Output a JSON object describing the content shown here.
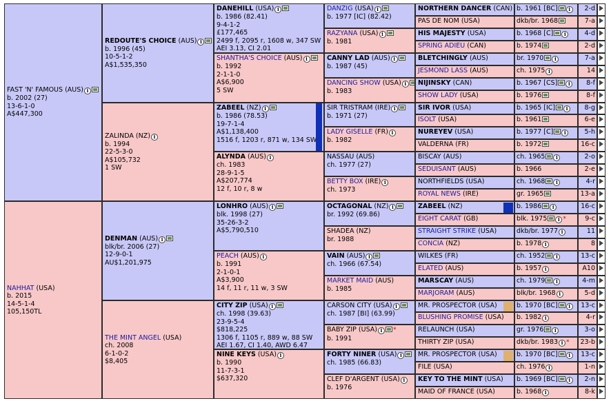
{
  "pedigree": {
    "g1": [
      {
        "name": "FAST 'N' FAMOUS",
        "nat": "(AUS)",
        "lines": [
          "b. 2002 (27)",
          "13-6-1-0",
          "A$447,300"
        ],
        "sex": "m",
        "bold": false,
        "link": false,
        "icons": [
          "info",
          "photo"
        ]
      },
      {
        "name": "NAHHAT",
        "nat": "(USA)",
        "lines": [
          "b. 2015",
          "14-5-1-4",
          "105,150TL"
        ],
        "sex": "f",
        "bold": false,
        "link": true,
        "icons": []
      }
    ],
    "g2": [
      {
        "name": "REDOUTE'S CHOICE",
        "nat": "(AUS)",
        "lines": [
          "b. 1996 (45)",
          "10-5-1-2",
          "A$1,535,350"
        ],
        "sex": "m",
        "bold": true,
        "link": false,
        "icons": [
          "info",
          "photo"
        ]
      },
      {
        "name": "ZALINDA",
        "nat": "(NZ)",
        "lines": [
          "b. 1994",
          "22-5-3-0",
          "A$105,732",
          "1 SW"
        ],
        "sex": "f",
        "bold": false,
        "link": false,
        "icons": [
          "info"
        ]
      },
      {
        "name": "DENMAN",
        "nat": "(AUS)",
        "lines": [
          "blk/br. 2006 (27)",
          "12-9-0-1",
          "AU$1,201,975"
        ],
        "sex": "m",
        "bold": true,
        "link": false,
        "icons": [
          "info",
          "photo"
        ]
      },
      {
        "name": "THE MINT ANGEL",
        "nat": "(USA)",
        "lines": [
          "ch. 2008",
          "6-1-0-2",
          "$8,405"
        ],
        "sex": "f",
        "bold": false,
        "link": true,
        "icons": []
      }
    ],
    "g3": [
      {
        "name": "DANEHILL",
        "nat": "(USA)",
        "lines": [
          "b. 1986 (82.41)",
          "9-4-1-2",
          "£177,465",
          "2499 f, 2095 r, 1608 w, 347 SW",
          "AEI 3.13, CI 2.01"
        ],
        "sex": "m",
        "bold": true,
        "link": false,
        "icons": [
          "info",
          "photo"
        ]
      },
      {
        "name": "SHANTHA'S CHOICE",
        "nat": "(AUS)",
        "lines": [
          "b. 1992",
          "2-1-1-0",
          "A$6,900",
          "5 SW"
        ],
        "sex": "f",
        "bold": false,
        "link": true,
        "icons": [
          "info",
          "photo"
        ]
      },
      {
        "name": "ZABEEL",
        "nat": "(NZ)",
        "lines": [
          "b. 1986 (78.53)",
          "19-7-1-4",
          "A$1,138,400",
          "1516 f, 1203 r, 871 w, 134 SW"
        ],
        "sex": "m",
        "bold": true,
        "link": false,
        "icons": [
          "info",
          "photo"
        ]
      },
      {
        "name": "ALYNDA",
        "nat": "(AUS)",
        "lines": [
          "ch. 1983",
          "28-9-1-5",
          "A$207,774",
          "12 f, 10 r, 8 w"
        ],
        "sex": "f",
        "bold": true,
        "link": false,
        "icons": [
          "info"
        ]
      },
      {
        "name": "LONHRO",
        "nat": "(AUS)",
        "lines": [
          "blk. 1998 (27)",
          "35-26-3-2",
          "A$5,790,510"
        ],
        "sex": "m",
        "bold": true,
        "link": false,
        "icons": [
          "info",
          "photo"
        ]
      },
      {
        "name": "PEACH",
        "nat": "(AUS)",
        "lines": [
          "b. 1991",
          "2-1-0-1",
          "A$3,900",
          "14 f, 11 r, 11 w, 3 SW"
        ],
        "sex": "f",
        "bold": false,
        "link": true,
        "icons": [
          "info"
        ]
      },
      {
        "name": "CITY ZIP",
        "nat": "(USA)",
        "lines": [
          "ch. 1998 (39.63)",
          "23-9-5-4",
          "$818,225",
          "1306 f, 1105 r, 889 w, 88 SW",
          "AEI 1.67, CI 1.40, AWD 6.47"
        ],
        "sex": "m",
        "bold": true,
        "link": false,
        "icons": [
          "info",
          "photo"
        ]
      },
      {
        "name": "NINE KEYS",
        "nat": "(USA)",
        "lines": [
          "b. 1990",
          "11-7-3-1",
          "$637,320"
        ],
        "sex": "f",
        "bold": true,
        "link": false,
        "icons": [
          "info"
        ]
      }
    ],
    "g4": [
      {
        "name": "DANZIG",
        "nat": "(USA)",
        "lines": [
          "b. 1977 [IC] (82.42)"
        ],
        "sex": "m",
        "bold": false,
        "link": true,
        "icons": [
          "info",
          "photo"
        ]
      },
      {
        "name": "RAZYANA",
        "nat": "(USA)",
        "lines": [
          "b. 1981"
        ],
        "sex": "f",
        "bold": false,
        "link": true,
        "icons": [
          "info",
          "photo"
        ]
      },
      {
        "name": "CANNY LAD",
        "nat": "(AUS)",
        "lines": [
          "b. 1987 (45)"
        ],
        "sex": "m",
        "bold": true,
        "link": false,
        "icons": [
          "info",
          "photo"
        ]
      },
      {
        "name": "DANCING SHOW",
        "nat": "(USA)",
        "lines": [
          "b. 1983"
        ],
        "sex": "f",
        "bold": false,
        "link": true,
        "icons": [
          "info",
          "photo"
        ]
      },
      {
        "name": "SIR TRISTRAM",
        "nat": "(IRE)",
        "lines": [
          "b. 1971 (27)"
        ],
        "sex": "m",
        "bold": false,
        "link": false,
        "icons": [
          "info",
          "photo"
        ]
      },
      {
        "name": "LADY GISELLE",
        "nat": "(FR)",
        "lines": [
          "b. 1982"
        ],
        "sex": "f",
        "bold": false,
        "link": true,
        "icons": [
          "info"
        ]
      },
      {
        "name": "NASSAU",
        "nat": "(AUS)",
        "lines": [
          "ch. 1977 (27)"
        ],
        "sex": "m",
        "bold": false,
        "link": false,
        "icons": []
      },
      {
        "name": "BETTY BOX",
        "nat": "(IRE)",
        "lines": [
          "ch. 1973"
        ],
        "sex": "f",
        "bold": false,
        "link": true,
        "icons": [
          "info"
        ]
      },
      {
        "name": "OCTAGONAL",
        "nat": "(NZ)",
        "lines": [
          "br. 1992 (69.86)"
        ],
        "sex": "m",
        "bold": true,
        "link": false,
        "icons": [
          "info",
          "photo"
        ]
      },
      {
        "name": "SHADEA",
        "nat": "(NZ)",
        "lines": [
          "br. 1988"
        ],
        "sex": "f",
        "bold": false,
        "link": false,
        "icons": []
      },
      {
        "name": "VAIN",
        "nat": "(AUS)",
        "lines": [
          "ch. 1966 (67.54)"
        ],
        "sex": "m",
        "bold": true,
        "link": false,
        "icons": [
          "info",
          "photo"
        ]
      },
      {
        "name": "MARKET MAID",
        "nat": "(AUS)",
        "lines": [
          "b. 1985"
        ],
        "sex": "f",
        "bold": false,
        "link": true,
        "icons": []
      },
      {
        "name": "CARSON CITY",
        "nat": "(USA)",
        "lines": [
          "ch. 1987 [BI] (63.99)"
        ],
        "sex": "m",
        "bold": false,
        "link": false,
        "icons": [
          "info",
          "photo"
        ]
      },
      {
        "name": "BABY ZIP",
        "nat": "(USA)",
        "lines": [
          "b. 1991"
        ],
        "sex": "f",
        "bold": false,
        "link": false,
        "icons": [
          "info",
          "photo"
        ],
        "star": "*"
      },
      {
        "name": "FORTY NINER",
        "nat": "(USA)",
        "lines": [
          "ch. 1985 (66.83)"
        ],
        "sex": "m",
        "bold": true,
        "link": false,
        "icons": [
          "info",
          "photo"
        ]
      },
      {
        "name": "CLEF D'ARGENT",
        "nat": "(USA)",
        "lines": [
          "b. 1976"
        ],
        "sex": "f",
        "bold": false,
        "link": false,
        "icons": [
          "info"
        ]
      }
    ],
    "g5": [
      {
        "name": "NORTHERN DANCER",
        "nat": "(CAN)",
        "info": "b. 1961 [BC]",
        "icons": [
          "photo",
          "info"
        ],
        "fam": "2-d",
        "sex": "m",
        "bold": true,
        "link": false
      },
      {
        "name": "PAS DE NOM",
        "nat": "(USA)",
        "info": "dkb/br. 1968",
        "icons": [
          "photo"
        ],
        "fam": "7-a",
        "sex": "f",
        "bold": false,
        "link": false
      },
      {
        "name": "HIS MAJESTY",
        "nat": "(USA)",
        "info": "b. 1968 [C]",
        "icons": [
          "photo",
          "info"
        ],
        "fam": "4-d",
        "sex": "m",
        "bold": true,
        "link": false
      },
      {
        "name": "SPRING ADIEU",
        "nat": "(CAN)",
        "info": "b. 1974",
        "icons": [
          "photo"
        ],
        "fam": "2-d",
        "sex": "f",
        "bold": false,
        "link": true
      },
      {
        "name": "BLETCHINGLY",
        "nat": "(AUS)",
        "info": "br. 1970",
        "icons": [
          "photo",
          "info"
        ],
        "fam": "7-a",
        "sex": "m",
        "bold": true,
        "link": false
      },
      {
        "name": "JESMOND LASS",
        "nat": "(AUS)",
        "info": "ch. 1975",
        "icons": [
          "info"
        ],
        "fam": "14",
        "sex": "f",
        "bold": false,
        "link": true
      },
      {
        "name": "NIJINSKY",
        "nat": "(CAN)",
        "info": "b. 1967 [CS]",
        "icons": [
          "photo",
          "info"
        ],
        "fam": "8-f",
        "sex": "m",
        "bold": true,
        "link": false
      },
      {
        "name": "SHOW LADY",
        "nat": "(USA)",
        "info": "b. 1976",
        "icons": [
          "photo"
        ],
        "fam": "8-f",
        "sex": "f",
        "bold": false,
        "link": true
      },
      {
        "name": "SIR IVOR",
        "nat": "(USA)",
        "info": "b. 1965 [IC]",
        "icons": [
          "photo",
          "info"
        ],
        "fam": "8-g",
        "sex": "m",
        "bold": true,
        "link": false
      },
      {
        "name": "ISOLT",
        "nat": "(USA)",
        "info": "b. 1961",
        "icons": [
          "photo"
        ],
        "fam": "6-e",
        "sex": "f",
        "bold": false,
        "link": true
      },
      {
        "name": "NUREYEV",
        "nat": "(USA)",
        "info": "b. 1977 [C]",
        "icons": [
          "photo",
          "info"
        ],
        "fam": "5-h",
        "sex": "m",
        "bold": true,
        "link": false
      },
      {
        "name": "VALDERNA",
        "nat": "(FR)",
        "info": "b. 1972",
        "icons": [
          "photo"
        ],
        "fam": "16-c",
        "sex": "f",
        "bold": false,
        "link": false
      },
      {
        "name": "BISCAY",
        "nat": "(AUS)",
        "info": "ch. 1965",
        "icons": [
          "photo",
          "info"
        ],
        "fam": "2-o",
        "sex": "m",
        "bold": false,
        "link": false
      },
      {
        "name": "SEDUISANT",
        "nat": "(AUS)",
        "info": "b. 1966",
        "icons": [],
        "fam": "2-e",
        "sex": "f",
        "bold": false,
        "link": true
      },
      {
        "name": "NORTHFIELDS",
        "nat": "(USA)",
        "info": "ch. 1968",
        "icons": [
          "photo",
          "info"
        ],
        "fam": "4-r",
        "sex": "m",
        "bold": false,
        "link": false
      },
      {
        "name": "ROYAL NEWS",
        "nat": "(IRE)",
        "info": "gr. 1965",
        "icons": [
          "photo"
        ],
        "fam": "13-a",
        "sex": "f",
        "bold": false,
        "link": true
      },
      {
        "name": "ZABEEL",
        "nat": "(NZ)",
        "info": "b. 1986",
        "icons": [
          "photo",
          "info"
        ],
        "fam": "16-c",
        "sex": "m",
        "bold": true,
        "link": false,
        "chip": "blue"
      },
      {
        "name": "EIGHT CARAT",
        "nat": "(GB)",
        "info": "blk. 1975",
        "icons": [
          "photo",
          "info"
        ],
        "fam": "9-c",
        "sex": "f",
        "bold": false,
        "link": true,
        "star": "*"
      },
      {
        "name": "STRAIGHT STRIKE",
        "nat": "(USA)",
        "info": "dkb/br. 1977",
        "icons": [
          "info"
        ],
        "fam": "11",
        "sex": "m",
        "bold": false,
        "link": true
      },
      {
        "name": "CONCIA",
        "nat": "(NZ)",
        "info": "b. 1978",
        "icons": [
          "info"
        ],
        "fam": "8",
        "sex": "f",
        "bold": false,
        "link": true
      },
      {
        "name": "WILKES",
        "nat": "(FR)",
        "info": "ch. 1952",
        "icons": [
          "photo",
          "info"
        ],
        "fam": "13-c",
        "sex": "m",
        "bold": false,
        "link": false
      },
      {
        "name": "ELATED",
        "nat": "(AUS)",
        "info": "b. 1957",
        "icons": [
          "info"
        ],
        "fam": "A10",
        "sex": "f",
        "bold": false,
        "link": true
      },
      {
        "name": "MARSCAY",
        "nat": "(AUS)",
        "info": "ch. 1979",
        "icons": [
          "photo",
          "info"
        ],
        "fam": "4-m",
        "sex": "m",
        "bold": true,
        "link": false
      },
      {
        "name": "MARJORAM",
        "nat": "(AUS)",
        "info": "blk/br. 1968",
        "icons": [
          "info"
        ],
        "fam": "5-d",
        "sex": "f",
        "bold": false,
        "link": true
      },
      {
        "name": "MR. PROSPECTOR",
        "nat": "(USA)",
        "info": "b. 1970 [BC]",
        "icons": [
          "photo",
          "info"
        ],
        "fam": "13-c",
        "sex": "m",
        "bold": false,
        "link": false,
        "chip": "tan"
      },
      {
        "name": "BLUSHING PROMISE",
        "nat": "(USA)",
        "info": "b. 1982",
        "icons": [
          "info"
        ],
        "fam": "4-r",
        "sex": "f",
        "bold": false,
        "link": true
      },
      {
        "name": "RELAUNCH",
        "nat": "(USA)",
        "info": "gr. 1976",
        "icons": [
          "photo",
          "info"
        ],
        "fam": "3-o",
        "sex": "m",
        "bold": false,
        "link": false
      },
      {
        "name": "THIRTY ZIP",
        "nat": "(USA)",
        "info": "dkb/br. 1983",
        "icons": [
          "info"
        ],
        "fam": "23-b",
        "sex": "f",
        "bold": false,
        "link": false,
        "star": "*"
      },
      {
        "name": "MR. PROSPECTOR",
        "nat": "(USA)",
        "info": "b. 1970 [BC]",
        "icons": [
          "photo",
          "info"
        ],
        "fam": "13-c",
        "sex": "m",
        "bold": false,
        "link": false,
        "chip": "tan"
      },
      {
        "name": "FILE",
        "nat": "(USA)",
        "info": "ch. 1976",
        "icons": [
          "info"
        ],
        "fam": "1-n",
        "sex": "f",
        "bold": false,
        "link": false
      },
      {
        "name": "KEY TO THE MINT",
        "nat": "(USA)",
        "info": "b. 1969 [BC]",
        "icons": [
          "photo",
          "info"
        ],
        "fam": "2-n",
        "sex": "m",
        "bold": true,
        "link": false
      },
      {
        "name": "MAID OF FRANCE",
        "nat": "(USA)",
        "info": "b. 1968",
        "icons": [
          "info"
        ],
        "fam": "8-k",
        "sex": "f",
        "bold": false,
        "link": false
      }
    ],
    "g3_chips": {
      "2": "blue"
    },
    "colors": {
      "male": "#c8c8f8",
      "female": "#f8c8c8",
      "link": "#1a1aa0",
      "chip_blue": "#1030b8",
      "chip_tan": "#e0b070"
    }
  }
}
